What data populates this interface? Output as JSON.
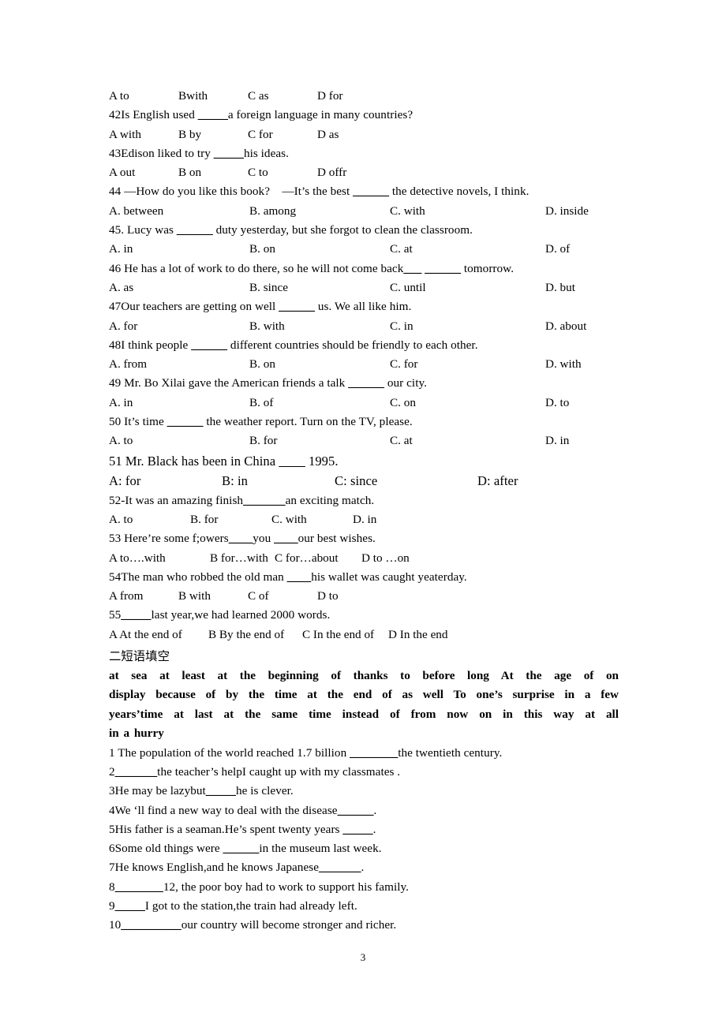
{
  "document": {
    "page_number": "3",
    "section_heading_cn": "二短语填空"
  },
  "multiple_choice": {
    "q41_options_line": {
      "a": "A to",
      "b": "Bwith",
      "c": "C as",
      "d": "D for"
    },
    "q42": {
      "stem_pre": "42Is English used ",
      "blank": "_____",
      "stem_post": "a foreign language in many countries?",
      "a": "A with",
      "b": "B by",
      "c": "C for",
      "d": "D as"
    },
    "q43": {
      "stem_pre": "43Edison liked to try ",
      "blank": "_____",
      "stem_post": "his ideas.",
      "a": "A out",
      "b": "B on",
      "c": "C to",
      "d": "D offr"
    },
    "q44": {
      "stem_pre": "44 —How do you like this book?    —It’s the best ",
      "blank": "______",
      "stem_post": " the detective novels, I think.",
      "a": "A. between",
      "b": "B. among",
      "c": "C. with",
      "d": "D. inside"
    },
    "q45": {
      "stem_pre": "45. Lucy was ",
      "blank": "______",
      "stem_post": " duty yesterday, but she forgot to clean the classroom.",
      "a": "A. in",
      "b": "B. on",
      "c": "C. at",
      "d": "D. of"
    },
    "q46": {
      "stem_pre": "46 He has a lot of work to do there, so he will not come back",
      "blank": "___",
      "stem_mid": " ",
      "blank2": "______",
      "stem_post": " tomorrow.",
      "a": "A. as",
      "b": "B. since",
      "c": "C. until",
      "d": "D. but"
    },
    "q47": {
      "stem_pre": "47Our teachers are getting on well ",
      "blank": "______",
      "stem_post": " us. We all like him.",
      "a": "A. for",
      "b": "B. with",
      "c": "C. in",
      "d": "D. about"
    },
    "q48": {
      "stem_pre": "48I think people ",
      "blank": "______",
      "stem_post": " different countries should be friendly to each other.",
      "a": "A. from",
      "b": "B. on",
      "c": "C. for",
      "d": "D. with"
    },
    "q49": {
      "stem_pre": "49 Mr. Bo Xilai gave the American friends a talk ",
      "blank": "______",
      "stem_post": " our city.",
      "a": "A. in",
      "b": "B. of",
      "c": "C. on",
      "d": "D. to"
    },
    "q50": {
      "stem_pre": "50 It’s time ",
      "blank": "______",
      "stem_post": " the weather report. Turn on the TV, please.",
      "a": "A. to",
      "b": "B. for",
      "c": "C. at",
      "d": "D. in"
    },
    "q51": {
      "stem_pre": "51 Mr. Black has been in China ",
      "blank": "____",
      "stem_post": " 1995.",
      "a": "A: for",
      "b": "B: in",
      "c": "C: since",
      "d": "D: after"
    },
    "q52": {
      "stem_pre": "52-It was an amazing finish",
      "blank": "_______",
      "stem_post": "an exciting match.",
      "a": "A. to",
      "b": "B. for",
      "c": "C. with",
      "d": "D. in"
    },
    "q53": {
      "stem_pre": "53 Here’re some f;owers",
      "blank": "____",
      "stem_mid": "you ",
      "blank2": "____",
      "stem_post": "our best wishes.",
      "a": "A to….with",
      "b": "B for…with",
      "c": "C for…about",
      "d": "D to …on"
    },
    "q54": {
      "stem_pre": "54The man who robbed the old man ",
      "blank": "____",
      "stem_post": "his wallet was caught yeaterday.",
      "a": "A from",
      "b": "B with",
      "c": "C of",
      "d": "D to"
    },
    "q55": {
      "stem_pre": "55",
      "blank": "_____",
      "stem_post": "last year,we had learned 2000 words.",
      "a": "A At the end of",
      "b": "B By the end of",
      "c": "C In the end of",
      "d": "D In the end"
    }
  },
  "phrase_bank": {
    "row1": "at sea    at least    at the beginning of   thanks to   before long At the age of     on",
    "row2": "display   because of    by the time      at the end of   as well To one’s surprise   in a few",
    "row3": "years’time   at last   at the same time     instead of   from now on   in this   way      at all",
    "row4": "in a hurry"
  },
  "fill_in_blanks": {
    "q1": {
      "pre": "1 The population of the world reached 1.7 billion ",
      "blank": "________",
      "post": "the twentieth century."
    },
    "q2": {
      "pre": "2",
      "blank": "_______",
      "post": "the teacher’s helpI caught up with my classmates ."
    },
    "q3": {
      "pre": "3He may be lazybut",
      "blank": "_____",
      "post": "he is clever."
    },
    "q4": {
      "pre": "4We ‘ll find a new way to deal with the disease",
      "blank": "______",
      "post": "."
    },
    "q5": {
      "pre": "5His father is a seaman.He’s spent twenty years ",
      "blank": "_____",
      "post": "."
    },
    "q6": {
      "pre": "6Some old things were ",
      "blank": "______",
      "post": "in the museum last week."
    },
    "q7": {
      "pre": "7He knows English,and he knows Japanese",
      "blank": "_______",
      "post": "."
    },
    "q8": {
      "pre": "8",
      "blank": "________",
      "post": "12, the poor boy had to work to support his family."
    },
    "q9": {
      "pre": "9",
      "blank": "_____",
      "post": "I got to the station,the train had already left."
    },
    "q10": {
      "pre": "10",
      "blank": "__________",
      "post": "our country will become stronger and richer."
    }
  }
}
